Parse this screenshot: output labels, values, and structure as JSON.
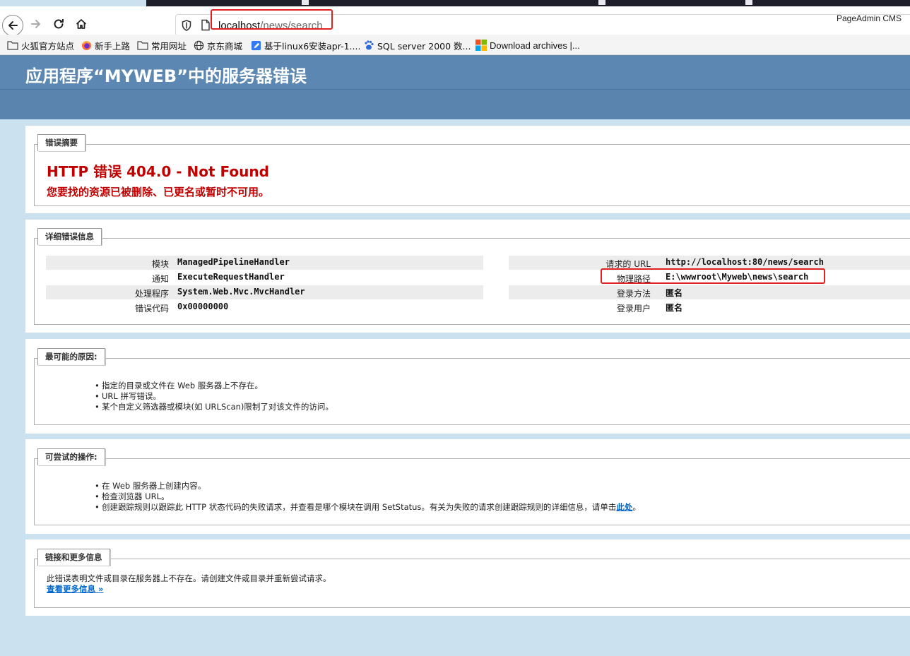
{
  "browser": {
    "url_host": "localhost",
    "url_path": "/news/search",
    "corner_label": "PageAdmin CMS",
    "bookmarks": [
      {
        "label": "火狐官方站点",
        "icon": "folder-icon"
      },
      {
        "label": "新手上路",
        "icon": "firefox-icon"
      },
      {
        "label": "常用网址",
        "icon": "folder-icon"
      },
      {
        "label": "京东商城",
        "icon": "globe-icon"
      },
      {
        "label": "基于linux6安装apr-1....",
        "icon": "pen-icon"
      },
      {
        "label": "SQL server 2000 数...",
        "icon": "baidu-paw-icon"
      },
      {
        "label": "Download archives |...",
        "icon": "microsoft-icon"
      }
    ]
  },
  "page": {
    "title": "应用程序“MYWEB”中的服务器错误",
    "summary": {
      "legend": "错误摘要",
      "error_title": "HTTP 错误 404.0 - Not Found",
      "error_desc": "您要找的资源已被删除、已更名或暂时不可用。"
    },
    "details": {
      "legend": "详细错误信息",
      "left": [
        {
          "label": "模块",
          "value": "ManagedPipelineHandler"
        },
        {
          "label": "通知",
          "value": "ExecuteRequestHandler"
        },
        {
          "label": "处理程序",
          "value": "System.Web.Mvc.MvcHandler"
        },
        {
          "label": "错误代码",
          "value": "0x00000000"
        }
      ],
      "right": [
        {
          "label": "请求的 URL",
          "value": "http://localhost:80/news/search"
        },
        {
          "label": "物理路径",
          "value": "E:\\wwwroot\\Myweb\\news\\search"
        },
        {
          "label": "登录方法",
          "value": "匿名"
        },
        {
          "label": "登录用户",
          "value": "匿名"
        }
      ]
    },
    "causes": {
      "legend": "最可能的原因:",
      "items": [
        "指定的目录或文件在 Web 服务器上不存在。",
        "URL 拼写错误。",
        "某个自定义筛选器或模块(如 URLScan)限制了对该文件的访问。"
      ]
    },
    "actions": {
      "legend": "可尝试的操作:",
      "items": [
        "在 Web 服务器上创建内容。",
        "检查浏览器 URL。"
      ],
      "last_item_text": "创建跟踪规则以跟踪此 HTTP 状态代码的失败请求，并查看是哪个模块在调用 SetStatus。有关为失败的请求创建跟踪规则的详细信息，请单击",
      "last_item_link": "此处",
      "last_item_end": "。"
    },
    "more": {
      "legend": "链接和更多信息",
      "text": "此错误表明文件或目录在服务器上不存在。请创建文件或目录并重新尝试请求。",
      "link": "查看更多信息 »"
    }
  }
}
